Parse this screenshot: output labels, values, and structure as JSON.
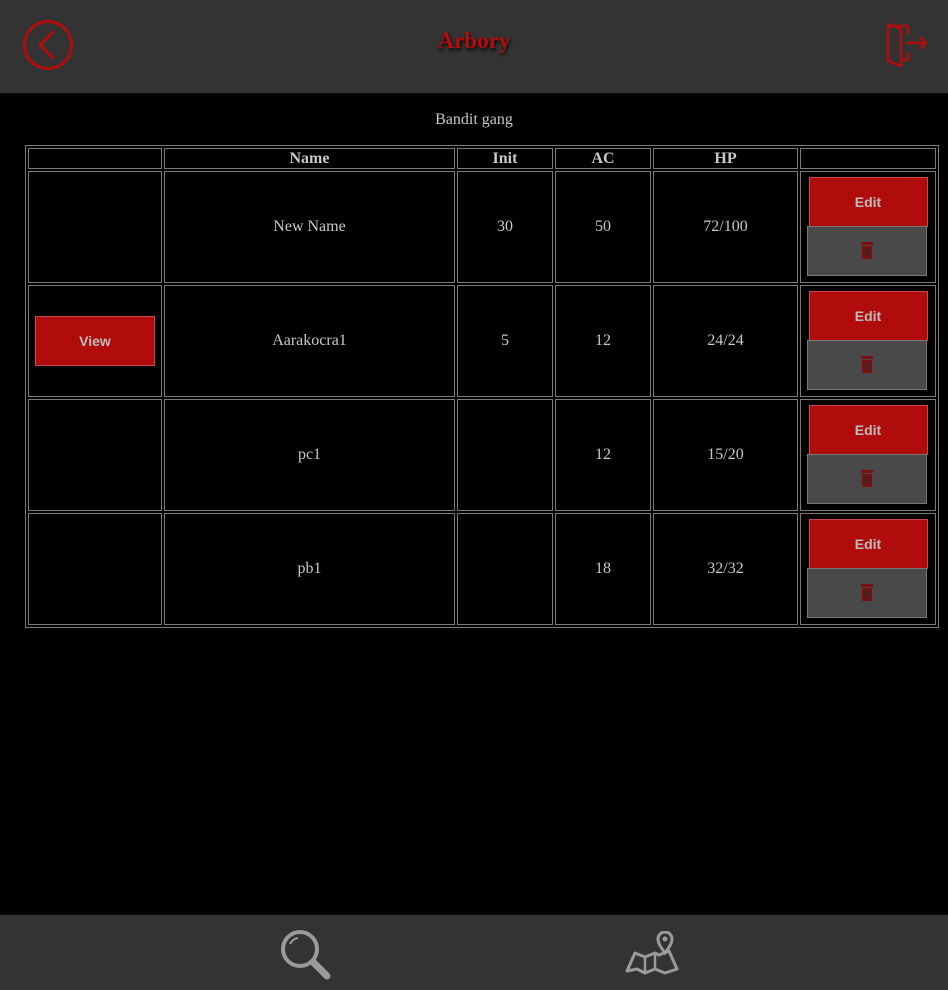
{
  "header": {
    "title": "Arbory",
    "back_icon": "back-arrow-circle-icon",
    "logout_icon": "exit-door-icon",
    "accent_color": "#b00e0e"
  },
  "group": {
    "name": "Bandit gang"
  },
  "table": {
    "columns": [
      "",
      "Name",
      "Init",
      "AC",
      "HP",
      ""
    ],
    "rows": [
      {
        "view": "",
        "name": "New Name",
        "init": "30",
        "ac": "50",
        "hp": "72/100",
        "edit": "Edit"
      },
      {
        "view": "View",
        "name": "Aarakocra1",
        "init": "5",
        "ac": "12",
        "hp": "24/24",
        "edit": "Edit"
      },
      {
        "view": "",
        "name": "pc1",
        "init": "",
        "ac": "12",
        "hp": "15/20",
        "edit": "Edit"
      },
      {
        "view": "",
        "name": "pb1",
        "init": "",
        "ac": "18",
        "hp": "32/32",
        "edit": "Edit"
      }
    ]
  },
  "footer": {
    "search_icon": "magnifier-icon",
    "map_icon": "map-pin-icon"
  }
}
